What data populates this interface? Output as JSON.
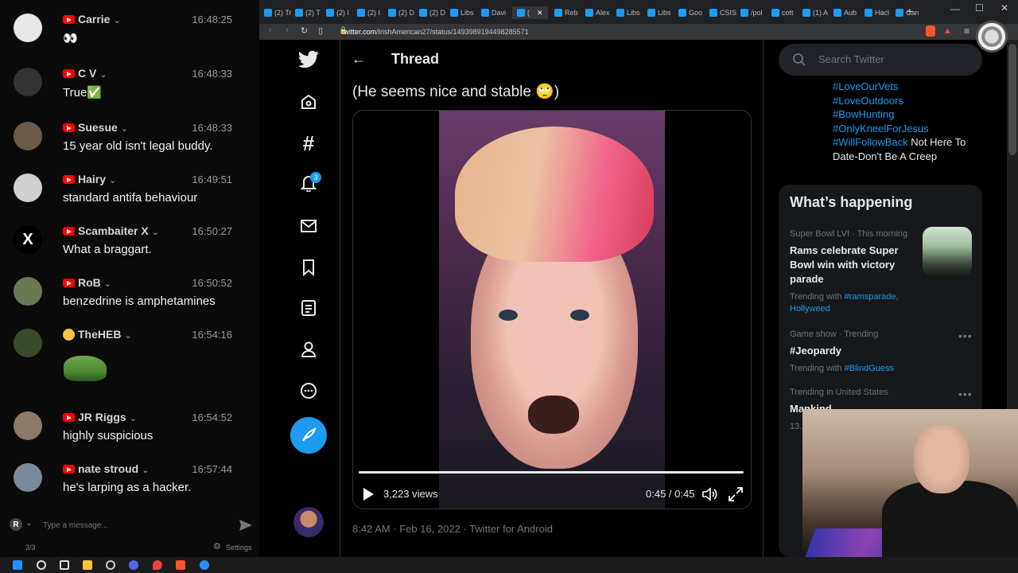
{
  "chat": {
    "messages": [
      {
        "user": "Carrie",
        "time": "16:48:25",
        "text": "👀",
        "avatar_color": "#e8e8e8",
        "avatar_glyph": ""
      },
      {
        "user": "C V",
        "time": "16:48:33",
        "text": "True✅",
        "avatar_color": "#333333",
        "avatar_glyph": ""
      },
      {
        "user": "Suesue",
        "time": "16:48:33",
        "text": "15 year old isn't legal buddy.",
        "avatar_color": "#6a5a4a",
        "avatar_glyph": ""
      },
      {
        "user": "Hairy",
        "time": "16:49:51",
        "text": "standard antifa behaviour",
        "avatar_color": "#cfcfcf",
        "avatar_glyph": ""
      },
      {
        "user": "Scambaiter X",
        "time": "16:50:27",
        "text": "What a braggart.",
        "avatar_color": "#000000",
        "avatar_glyph": "X"
      },
      {
        "user": "RoB",
        "time": "16:50:52",
        "text": "benzedrine is amphetamines",
        "avatar_color": "#6b7a55",
        "avatar_glyph": ""
      },
      {
        "user": "TheHEB",
        "time": "16:54:16",
        "text": "",
        "avatar_color": "#3a4a2a",
        "avatar_glyph": ""
      },
      {
        "user": "JR Riggs",
        "time": "16:54:52",
        "text": "highly suspicious",
        "avatar_color": "#8a7a6a",
        "avatar_glyph": ""
      },
      {
        "user": "nate stroud",
        "time": "16:57:44",
        "text": "he's larping as a hacker.",
        "avatar_color": "#7a8a9a",
        "avatar_glyph": ""
      }
    ],
    "input_placeholder": "Type a message...",
    "input_avatar": "R",
    "counter": "3/3",
    "settings_label": "Settings"
  },
  "browser": {
    "tabs": [
      "(2) Tr",
      "(2) T",
      "(2) I",
      "(2) I",
      "(2) D",
      "(2) D",
      "Libs",
      "Davi",
      "(",
      "Reb",
      "Alex",
      "Libs",
      "Libs",
      "Goo",
      "CSIS",
      "/pol",
      "cott",
      "(1) A",
      "Aub",
      "Hacl",
      "Can"
    ],
    "url_host": "twitter.com",
    "url_path": "/IrishAmerican27/status/1493989194498285571"
  },
  "twitter": {
    "header_title": "Thread",
    "tweet_text": "(He seems nice and stable 🙄)",
    "video_views": "3,223 views",
    "video_time": "0:45 / 0:45",
    "tweet_meta": "8:42 AM · Feb 16, 2022 · Twitter for Android",
    "notification_count": "3",
    "search_placeholder": "Search Twitter",
    "bio_lines": [
      {
        "tag": "#LoveOurVets",
        "rest": ""
      },
      {
        "tag": "#LoveOutdoors",
        "rest": ""
      },
      {
        "tag": "#BowHunting",
        "rest": ""
      },
      {
        "tag": "#OnlyKneelForJesus",
        "rest": ""
      },
      {
        "tag": "#WillFollowBack",
        "rest": " Not Here To Date-Don't Be A Creep"
      }
    ],
    "happening_title": "What’s happening",
    "trends": [
      {
        "context": "Super Bowl LVI · This morning",
        "title": "Rams celebrate Super Bowl win with victory parade",
        "with_label": "Trending with ",
        "with_tags": "#ramsparade, Hollyweed"
      },
      {
        "context": "Game show · Trending",
        "title": "#Jeopardy",
        "with_label": "Trending with ",
        "with_tags": "#BlindGuess"
      },
      {
        "context": "Trending in United States",
        "title": "Mankind",
        "with_label": "13.",
        "with_tags": ""
      }
    ]
  }
}
